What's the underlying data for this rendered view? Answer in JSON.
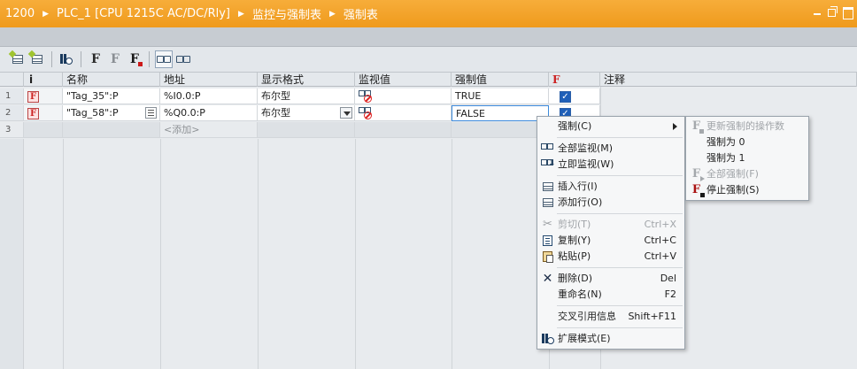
{
  "breadcrumb": [
    "1200",
    "PLC_1 [CPU 1215C AC/DC/Rly]",
    "监控与强制表",
    "强制表"
  ],
  "columns": {
    "info": "i",
    "name": "名称",
    "address": "地址",
    "display_format": "显示格式",
    "monitor_value": "监视值",
    "force_value": "强制值",
    "force": "F",
    "comment": "注释"
  },
  "rows": [
    {
      "num": "1",
      "name": "\"Tag_35\":P",
      "address": "%I0.0:P",
      "display_format": "布尔型",
      "force_value": "TRUE",
      "checked": true
    },
    {
      "num": "2",
      "name": "\"Tag_58\":P",
      "address": "%Q0.0:P",
      "display_format": "布尔型",
      "force_value": "FALSE",
      "checked": true
    }
  ],
  "add_row": {
    "num": "3",
    "label": "<添加>"
  },
  "context_menu": {
    "force": "强制(C)",
    "monitor_all": "全部监视(M)",
    "monitor_now": "立即监视(W)",
    "insert_row": "插入行(I)",
    "add_row": "添加行(O)",
    "cut": "剪切(T)",
    "cut_sc": "Ctrl+X",
    "copy": "复制(Y)",
    "copy_sc": "Ctrl+C",
    "paste": "粘贴(P)",
    "paste_sc": "Ctrl+V",
    "delete": "删除(D)",
    "delete_sc": "Del",
    "rename": "重命名(N)",
    "rename_sc": "F2",
    "cross_ref": "交叉引用信息",
    "cross_ref_sc": "Shift+F11",
    "extended_mode": "扩展模式(E)"
  },
  "submenu": {
    "update_forced": "更新强制的操作数",
    "force_0": "强制为 0",
    "force_1": "强制为 1",
    "force_all": "全部强制(F)",
    "stop_forcing": "停止强制(S)"
  },
  "colors": {
    "title_bar": "#ef9a1c",
    "check": "#1f5fb8",
    "force_badge": "#cc2222"
  }
}
